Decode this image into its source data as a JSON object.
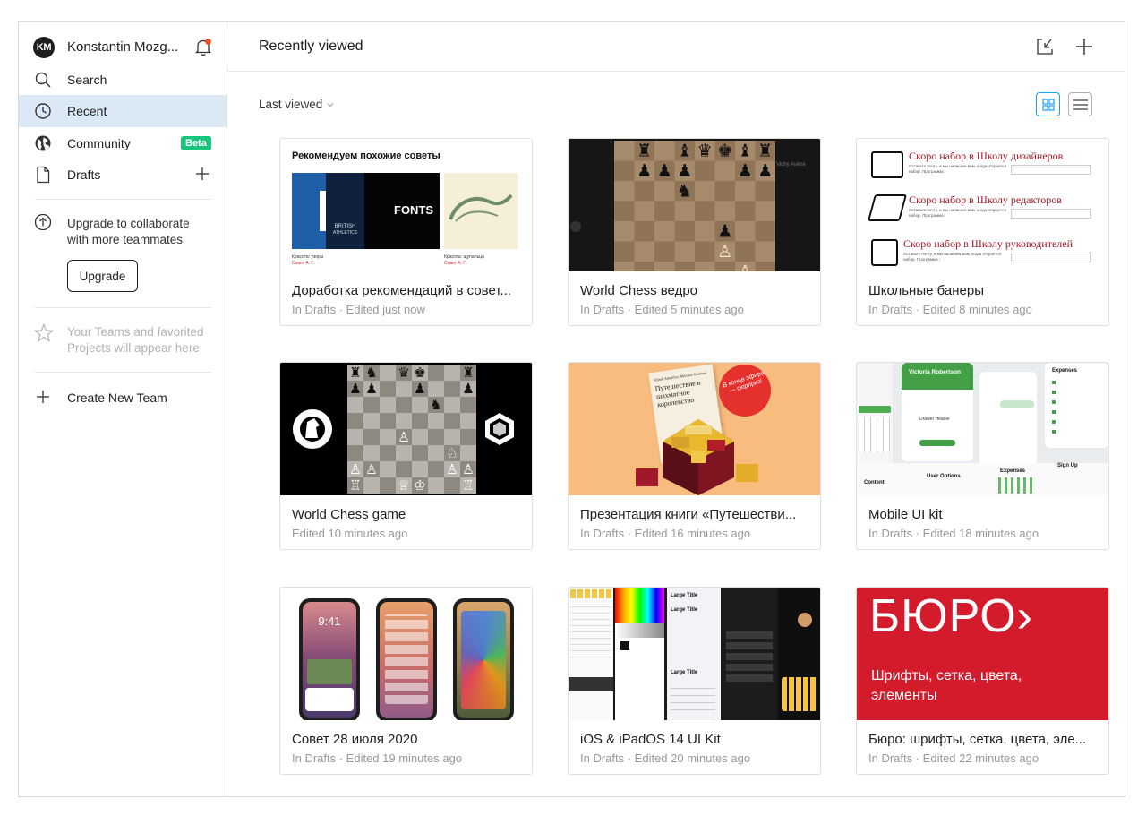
{
  "sidebar": {
    "account": {
      "initials": "KM",
      "name": "Konstantin Mozg..."
    },
    "nav": [
      {
        "label": "Search",
        "icon": "search-icon"
      },
      {
        "label": "Recent",
        "icon": "clock-icon",
        "active": true
      },
      {
        "label": "Community",
        "icon": "globe-icon",
        "badge": "Beta"
      },
      {
        "label": "Drafts",
        "icon": "file-icon"
      }
    ],
    "upgrade": {
      "text": "Upgrade to collaborate with more teammates",
      "button": "Upgrade"
    },
    "teams_hint": "Your Teams and favorited Projects will appear here",
    "create_team": "Create New Team"
  },
  "header": {
    "title": "Recently viewed"
  },
  "toolbar": {
    "sort_label": "Last viewed"
  },
  "files": [
    {
      "title": "Доработка рекомендаций в совет...",
      "meta": "In Drafts · Edited just now"
    },
    {
      "title": "World Chess ведро",
      "meta": "In Drafts · Edited 5 minutes ago"
    },
    {
      "title": "Школьные банеры",
      "meta": "In Drafts · Edited 8 minutes ago"
    },
    {
      "title": "World Chess game",
      "meta": "Edited 10 minutes ago"
    },
    {
      "title": "Презентация книги «Путешестви...",
      "meta": "In Drafts · Edited 16 minutes ago"
    },
    {
      "title": "Mobile UI kit",
      "meta": "In Drafts · Edited 18 minutes ago"
    },
    {
      "title": "Совет 28 июля 2020",
      "meta": "In Drafts · Edited 19 minutes ago"
    },
    {
      "title": "iOS & iPadOS 14 UI Kit",
      "meta": "In Drafts · Edited 20 minutes ago"
    },
    {
      "title": "Бюро: шрифты, сетка, цвета, эле...",
      "meta": "In Drafts · Edited 22 minutes ago"
    }
  ],
  "thumbs": {
    "rec": {
      "heading": "Рекомендуем похожие советы",
      "fonts": "FONTS",
      "british": "BRITISH",
      "athletics": "ATHLETICS",
      "cap1": "Красота: узоры",
      "cap1b": "Совет А. Г.",
      "cap2": "Красота: щупальца",
      "cap2b": "Совет А. Г."
    },
    "school": [
      "Скоро набор в Школу дизайнеров",
      "Скоро набор в Школу редакторов",
      "Скоро набор в Школу руководителей"
    ],
    "school_note": "Оставьте почту, и мы напишем вам, когда откроется набор. Программа ›",
    "chess_side": "Vichy Avène",
    "book": {
      "authors": "Юрий Авербах, Михаил Бейлин",
      "title": "Путешествие в шахматное королевство",
      "sticker": "В конце эфира — сюрприз!"
    },
    "mobile": {
      "name": "Victoria Robertson",
      "drawer": "Drawer Header",
      "expenses": "Expenses",
      "content": "Content",
      "user_options": "User Options",
      "sign_up": "Sign Up"
    },
    "phone_time": "9:41",
    "ios_large_title": "Large Title",
    "buro": {
      "logo": "БЮРО›",
      "subtitle": "Шрифты, сетка, цвета, элементы"
    }
  },
  "colors": {
    "accent": "#18a0fb",
    "active_bg": "#dbe9f6",
    "beta": "#1bc47d",
    "buro_red": "#d41b2c",
    "notify": "#f24e1e"
  }
}
